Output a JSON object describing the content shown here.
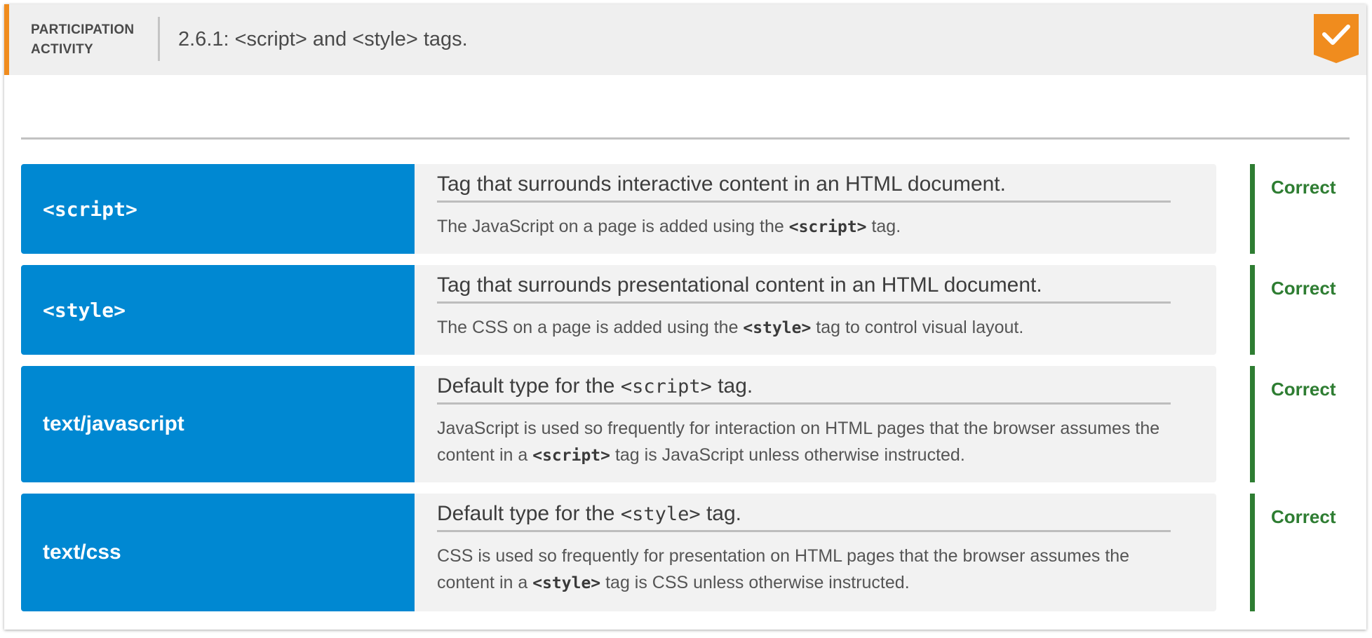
{
  "header": {
    "label_line1": "PARTICIPATION",
    "label_line2": "ACTIVITY",
    "title": "2.6.1: <script> and <style> tags.",
    "accent_color": "#f08c1e",
    "badge_icon": "checkmark-icon"
  },
  "rows": [
    {
      "term": "<script>",
      "definition_title": "Tag that surrounds interactive content in an HTML document.",
      "explanation": {
        "before": "The JavaScript on a page is added using the ",
        "code": "<script>",
        "after": " tag."
      },
      "status": "Correct"
    },
    {
      "term": "<style>",
      "definition_title": "Tag that surrounds presentational content in an HTML document.",
      "explanation": {
        "before": "The CSS on a page is added using the ",
        "code": "<style>",
        "after": " tag to control visual layout."
      },
      "status": "Correct"
    },
    {
      "term": "text/javascript",
      "definition_title": {
        "before": "Default type for the ",
        "code": "<script>",
        "after": " tag."
      },
      "explanation": {
        "before": "JavaScript is used so frequently for interaction on HTML pages that the browser assumes the content in a ",
        "code": "<script>",
        "after": " tag is JavaScript unless otherwise instructed."
      },
      "status": "Correct"
    },
    {
      "term": "text/css",
      "definition_title": {
        "before": "Default type for the ",
        "code": "<style>",
        "after": " tag."
      },
      "explanation": {
        "before": "CSS is used so frequently for presentation on HTML pages that the browser assumes the content in a ",
        "code": "<style>",
        "after": " tag is CSS unless otherwise instructed."
      },
      "status": "Correct"
    }
  ],
  "colors": {
    "term_background": "#0088d2",
    "definition_background": "#f2f2f2",
    "correct": "#2e7d32"
  }
}
